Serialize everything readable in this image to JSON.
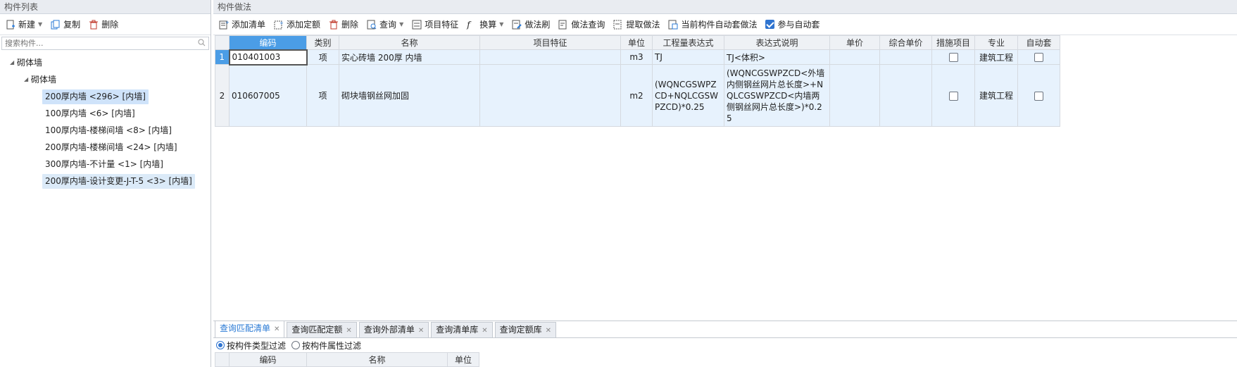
{
  "left_panel": {
    "title": "构件列表",
    "toolbar": {
      "new": "新建",
      "copy": "复制",
      "delete": "删除"
    },
    "search_placeholder": "搜索构件...",
    "tree_root": "砌体墙",
    "tree_child": "砌体墙",
    "items": [
      "200厚内墙 <296> [内墙]",
      "100厚内墙 <6> [内墙]",
      "100厚内墙-楼梯间墙 <8> [内墙]",
      "200厚内墙-楼梯间墙 <24> [内墙]",
      "300厚内墙-不计量 <1> [内墙]",
      "200厚内墙-设计变更-J-T-5 <3> [内墙]"
    ]
  },
  "right_panel": {
    "title": "构件做法",
    "toolbar": {
      "add_list": "添加清单",
      "add_quota": "添加定额",
      "delete": "删除",
      "query": "查询",
      "item_feature": "项目特征",
      "convert": "换算",
      "method_brush": "做法刷",
      "method_query": "做法查询",
      "extract_method": "提取做法",
      "auto_method": "当前构件自动套做法",
      "participate_auto": "参与自动套"
    },
    "columns": [
      "编码",
      "类别",
      "名称",
      "项目特征",
      "单位",
      "工程量表达式",
      "表达式说明",
      "单价",
      "综合单价",
      "措施项目",
      "专业",
      "自动套"
    ],
    "rows": [
      {
        "num": "1",
        "code": "010401003",
        "category": "项",
        "name": "实心砖墙 200厚 内墙",
        "feature": "",
        "unit": "m3",
        "expr": "TJ",
        "expr_desc": "TJ<体积>",
        "price": "",
        "comp_price": "",
        "specialty": "建筑工程"
      },
      {
        "num": "2",
        "code": "010607005",
        "category": "项",
        "name": "砌块墙钢丝网加固",
        "feature": "",
        "unit": "m2",
        "expr": "(WQNCGSWPZCD+NQLCGSWPZCD)*0.25",
        "expr_desc": "(WQNCGSWPZCD<外墙内侧钢丝网片总长度>+NQLCGSWPZCD<内墙两侧钢丝网片总长度>)*0.25",
        "price": "",
        "comp_price": "",
        "specialty": "建筑工程"
      }
    ]
  },
  "bottom_panel": {
    "tabs": [
      "查询匹配清单",
      "查询匹配定额",
      "查询外部清单",
      "查询清单库",
      "查询定额库"
    ],
    "filters": [
      "按构件类型过滤",
      "按构件属性过滤"
    ],
    "columns": [
      "编码",
      "名称",
      "单位"
    ]
  }
}
